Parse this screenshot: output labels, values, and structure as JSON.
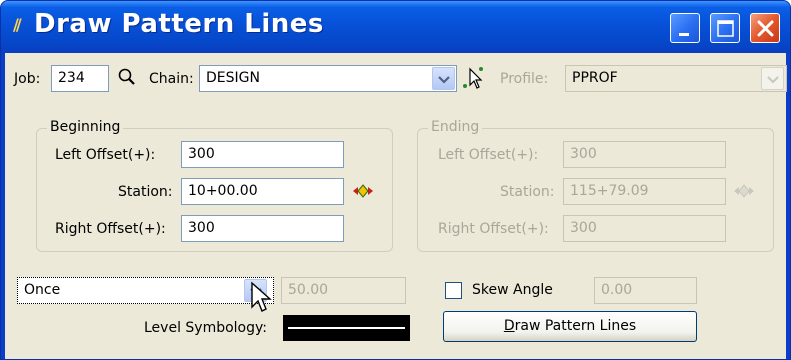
{
  "window": {
    "title": "Draw Pattern Lines",
    "icon": "pattern-app-icon"
  },
  "header": {
    "job_label": "Job:",
    "job_value": "234",
    "chain_label": "Chain:",
    "chain_value": "DESIGN",
    "profile_label": "Profile:",
    "profile_value": "PPROF"
  },
  "beginning": {
    "title": "Beginning",
    "left_offset_label": "Left Offset(+):",
    "left_offset_value": "300",
    "station_label": "Station:",
    "station_value": "10+00.00",
    "right_offset_label": "Right Offset(+):",
    "right_offset_value": "300"
  },
  "ending": {
    "title": "Ending",
    "left_offset_label": "Left Offset(+):",
    "left_offset_value": "300",
    "station_label": "Station:",
    "station_value": "115+79.09",
    "right_offset_label": "Right Offset(+):",
    "right_offset_value": "300"
  },
  "pattern": {
    "mode_value": "Once",
    "interval_value": "50.00"
  },
  "skew": {
    "label": "Skew Angle",
    "checked": false,
    "value": "0.00"
  },
  "level_symbology_label": "Level Symbology:",
  "draw_button": {
    "label_first": "D",
    "label_rest": "raw Pattern Lines"
  },
  "colors": {
    "titlebar": "#0a5fe6",
    "client": "#ece9d8",
    "field_border": "#7f9db9",
    "disabled_text": "#a9a69a",
    "close_button": "#e4582c"
  }
}
